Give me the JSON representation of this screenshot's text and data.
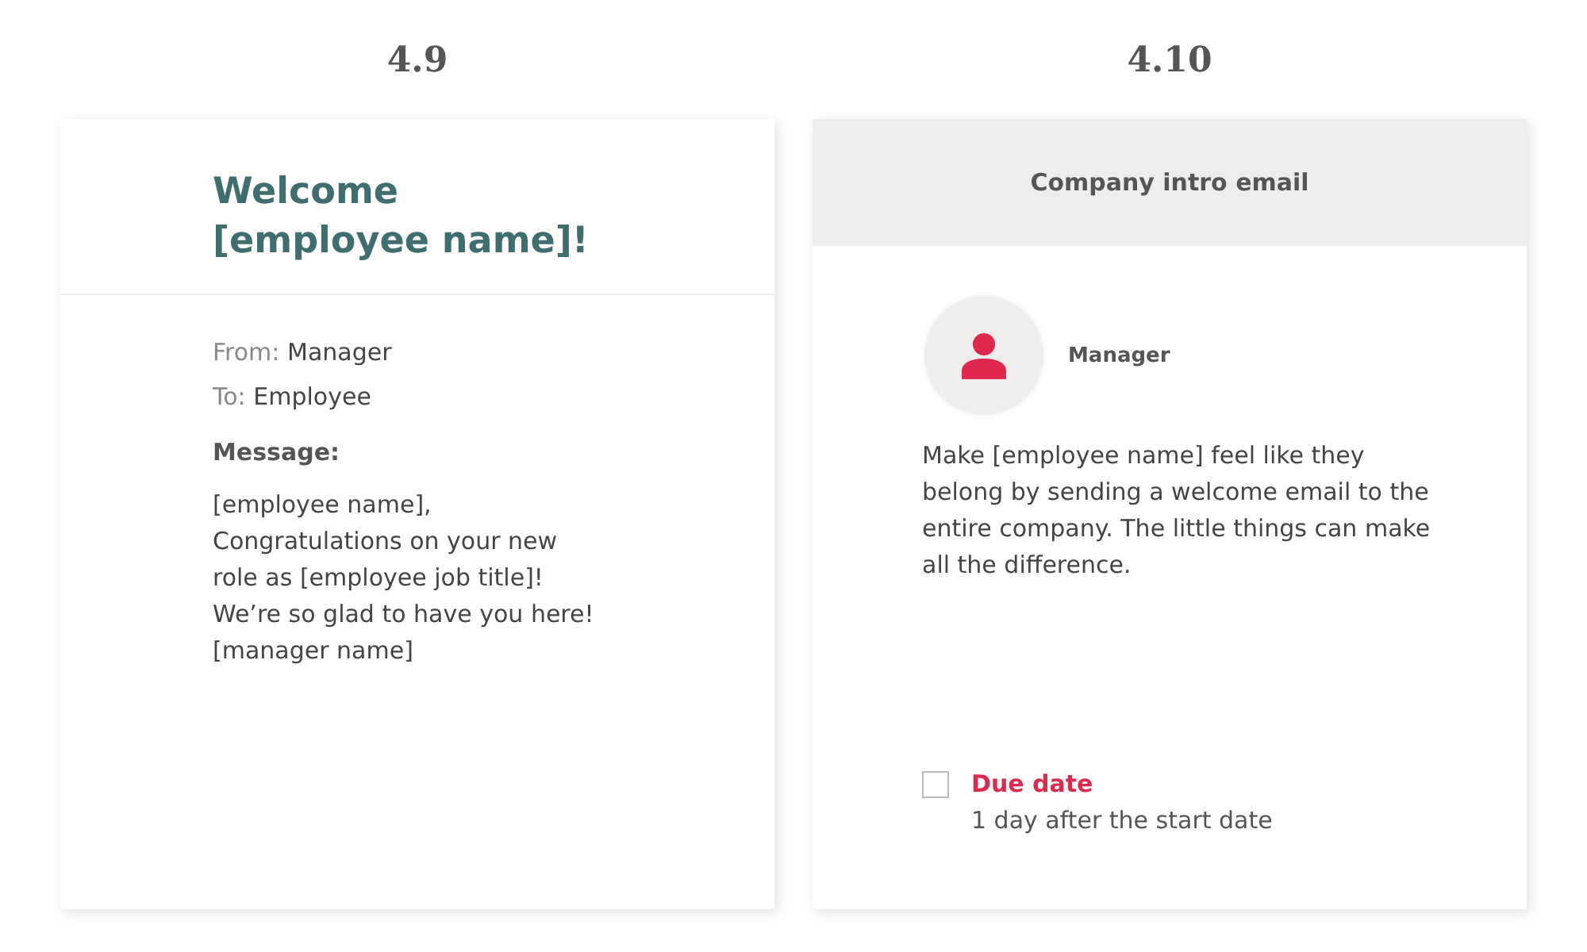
{
  "panels": [
    {
      "kind": "email",
      "label": "4.9",
      "title": "Welcome\n[employee name]!",
      "from_label": "From:",
      "from": "Manager",
      "to_label": "To:",
      "to": "Employee",
      "message_label": "Message:",
      "message": "[employee name],\nCongratulations on your new\nrole as [employee job title]!\nWe’re so glad to have you here!\n[manager name]"
    },
    {
      "kind": "task",
      "label": "4.10",
      "header": "Company intro email",
      "assignee": "Manager",
      "description": "Make [employee name] feel like they belong by sending a welcome email to the entire company. The little things can make all the difference.",
      "due_checked": false,
      "due_label": "Due date",
      "due_value": "1 day after the start date"
    }
  ]
}
